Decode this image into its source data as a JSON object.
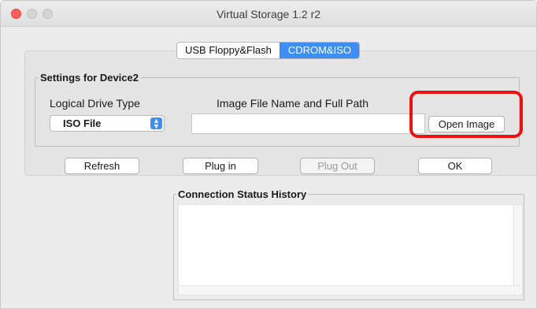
{
  "window": {
    "title": "Virtual Storage 1.2 r2"
  },
  "tabs": [
    {
      "label": "USB Floppy&Flash",
      "active": false
    },
    {
      "label": "CDROM&ISO",
      "active": true
    }
  ],
  "settings": {
    "legend": "Settings for Device2",
    "drive_type_label": "Logical Drive Type",
    "drive_type_value": "ISO File",
    "image_path_label": "Image File Name and Full Path",
    "image_path_value": "",
    "open_image_label": "Open Image"
  },
  "buttons": {
    "refresh": "Refresh",
    "plug_in": "Plug in",
    "plug_out": "Plug Out",
    "ok": "OK"
  },
  "history": {
    "legend": "Connection Status History",
    "entries": []
  },
  "colors": {
    "accent": "#3f8ef5",
    "highlight": "#ee1111",
    "close": "#fc605c"
  }
}
